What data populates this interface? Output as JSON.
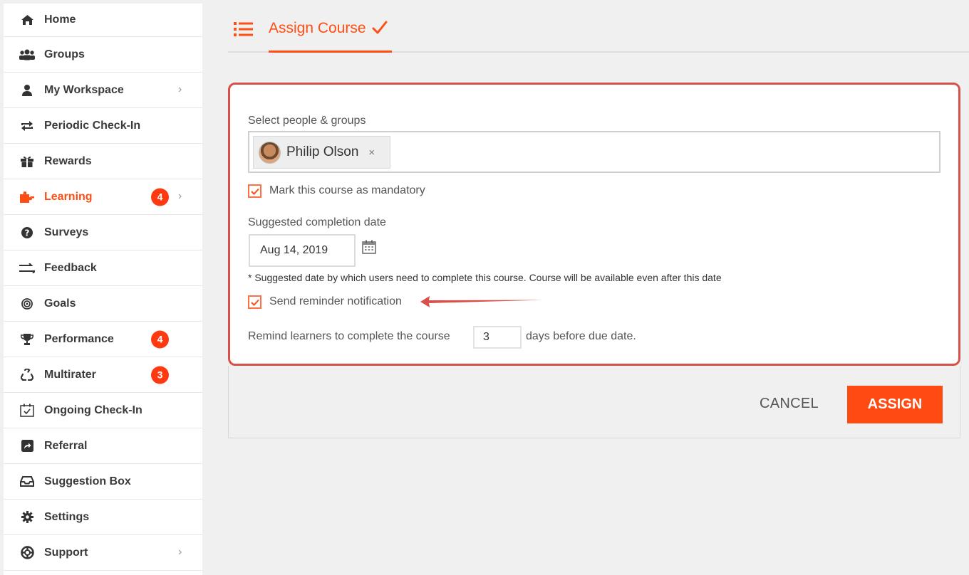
{
  "sidebar": {
    "items": [
      {
        "label": "Home",
        "icon": "home-icon",
        "badge": "",
        "chevron": false,
        "active": false
      },
      {
        "label": "Groups",
        "icon": "groups-icon",
        "badge": "",
        "chevron": false,
        "active": false
      },
      {
        "label": "My Workspace",
        "icon": "user-icon",
        "badge": "",
        "chevron": true,
        "active": false
      },
      {
        "label": "Periodic Check-In",
        "icon": "refresh-icon",
        "badge": "",
        "chevron": false,
        "active": false
      },
      {
        "label": "Rewards",
        "icon": "gift-icon",
        "badge": "",
        "chevron": false,
        "active": false
      },
      {
        "label": "Learning",
        "icon": "puzzle-icon",
        "badge": "4",
        "chevron": true,
        "active": true
      },
      {
        "label": "Surveys",
        "icon": "question-icon",
        "badge": "",
        "chevron": false,
        "active": false
      },
      {
        "label": "Feedback",
        "icon": "exchange-icon",
        "badge": "",
        "chevron": false,
        "active": false
      },
      {
        "label": "Goals",
        "icon": "target-icon",
        "badge": "",
        "chevron": false,
        "active": false
      },
      {
        "label": "Performance",
        "icon": "trophy-icon",
        "badge": "4",
        "chevron": false,
        "active": false
      },
      {
        "label": "Multirater",
        "icon": "recycle-icon",
        "badge": "3",
        "chevron": false,
        "active": false
      },
      {
        "label": "Ongoing Check-In",
        "icon": "calendar-check-icon",
        "badge": "",
        "chevron": false,
        "active": false
      },
      {
        "label": "Referral",
        "icon": "share-icon",
        "badge": "",
        "chevron": false,
        "active": false
      },
      {
        "label": "Suggestion Box",
        "icon": "inbox-icon",
        "badge": "",
        "chevron": false,
        "active": false
      },
      {
        "label": "Settings",
        "icon": "gear-icon",
        "badge": "",
        "chevron": false,
        "active": false
      },
      {
        "label": "Support",
        "icon": "lifebuoy-icon",
        "badge": "",
        "chevron": true,
        "active": false
      }
    ]
  },
  "header": {
    "tab_label": "Assign Course",
    "tab_icon": "list-icon",
    "check_icon": "checkmark-icon"
  },
  "form": {
    "people_label": "Select people & groups",
    "selected_person": "Philip Olson",
    "chip_remove": "×",
    "mandatory_label": "Mark this course as mandatory",
    "mandatory_checked": true,
    "date_label": "Suggested completion date",
    "date_value": "Aug 14, 2019",
    "note": "* Suggested date by which users need to complete this course. Course will be available even after this date",
    "reminder_label": "Send reminder notification",
    "reminder_checked": true,
    "remind_prefix": "Remind learners to complete the course",
    "remind_days": "3",
    "remind_suffix": "days before due date."
  },
  "actions": {
    "cancel": "CANCEL",
    "assign": "ASSIGN"
  },
  "colors": {
    "accent": "#ff4e14",
    "highlight_border": "#d8504a",
    "badge": "#ff3a10"
  }
}
